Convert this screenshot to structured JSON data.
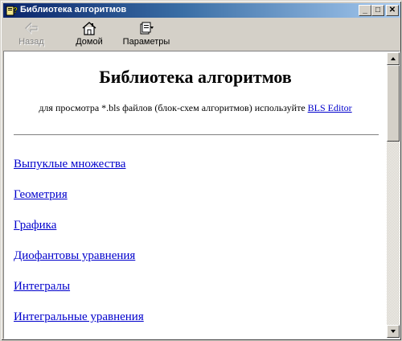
{
  "window": {
    "title": "Библиотека алгоритмов",
    "minimize_glyph": "_",
    "maximize_glyph": "□",
    "close_glyph": "✕",
    "title_icon": "help-book-icon"
  },
  "toolbar": {
    "back_label": "Назад",
    "back_icon": "back-arrow-icon",
    "back_enabled": false,
    "home_label": "Домой",
    "home_icon": "house-icon",
    "options_label": "Параметры",
    "options_icon": "options-icon"
  },
  "page": {
    "title": "Библиотека алгоритмов",
    "subtitle_prefix": "для просмотра *.bls файлов (блок-схем алгоритмов) используйте ",
    "subtitle_link": "BLS Editor",
    "links": [
      "Выпуклые множества",
      "Геометрия",
      "Графика",
      "Диофантовы уравнения",
      "Интегралы",
      "Интегральные уравнения"
    ]
  },
  "colors": {
    "link": "#0000cc",
    "titlebar_start": "#0a246a",
    "titlebar_end": "#a6caf0",
    "chrome": "#d4d0c8"
  }
}
